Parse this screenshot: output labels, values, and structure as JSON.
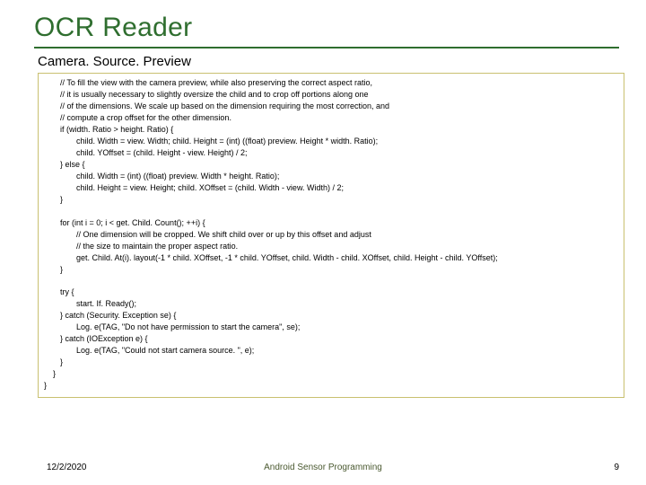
{
  "title": "OCR Reader",
  "subtitle": "Camera. Source. Preview",
  "code": {
    "b1": {
      "l1": "// To fill the view with the camera preview, while also preserving the correct aspect ratio,",
      "l2": "// it is usually necessary to slightly oversize the child and to crop off portions along one",
      "l3": "// of the dimensions.  We scale up based on the dimension requiring the most correction, and",
      "l4": "// compute a crop offset for the other dimension.",
      "l5": "if (width. Ratio > height. Ratio) {",
      "l6": "child. Width = view. Width;   child. Height = (int) ((float) preview. Height * width. Ratio);",
      "l7": "child. YOffset = (child. Height - view. Height) / 2;",
      "l8": "} else {",
      "l9": "child. Width = (int) ((float) preview. Width * height. Ratio);",
      "l10": "child. Height = view. Height;   child. XOffset = (child. Width - view. Width) / 2;",
      "l11": "}"
    },
    "b2": {
      "l1": "for (int i = 0; i < get. Child. Count(); ++i) {",
      "l2": "// One dimension will be cropped.  We shift child over or up by this offset and adjust",
      "l3": "// the size to maintain the proper aspect ratio.",
      "l4": "get. Child. At(i). layout(-1 * child. XOffset, -1 * child. YOffset, child. Width - child. XOffset, child. Height - child. YOffset);",
      "l5": "}"
    },
    "b3": {
      "l1": "try {",
      "l2": "start. If. Ready();",
      "l3": "} catch (Security. Exception se) {",
      "l4": "Log. e(TAG, \"Do not have permission to start the camera\", se);",
      "l5": "} catch (IOException e) {",
      "l6": "Log. e(TAG, \"Could not start camera source. \", e);",
      "l7": "}",
      "l8": "}",
      "l9": "}"
    }
  },
  "footer": {
    "date": "12/2/2020",
    "center": "Android Sensor Programming",
    "page": "9"
  }
}
